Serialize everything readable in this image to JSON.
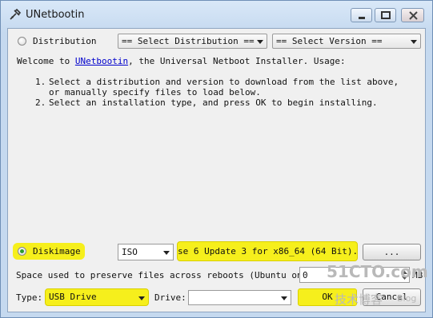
{
  "window": {
    "title": "UNetbootin"
  },
  "distribution": {
    "label": "Distribution",
    "select_distribution": "== Select Distribution ==",
    "select_version": "== Select Version =="
  },
  "welcome": {
    "prefix": "Welcome to ",
    "link": "UNetbootin",
    "suffix": ", the Universal Netboot Installer. Usage:"
  },
  "instructions": [
    {
      "num": "1.",
      "text": "Select a distribution and version to download from the list above, or manually specify files to load below."
    },
    {
      "num": "2.",
      "text": "Select an installation type, and press OK to begin installing."
    }
  ],
  "diskimage": {
    "label": "Diskimage",
    "type_value": "ISO",
    "file_path": "se 6 Update 3 for x86_64 (64 Bit).iso",
    "browse_label": "..."
  },
  "persistence": {
    "label": "Space used to preserve files across reboots (Ubuntu only):",
    "value": "0",
    "unit": "MB"
  },
  "install": {
    "type_label": "Type:",
    "type_value": "USB Drive",
    "drive_label": "Drive:",
    "drive_value": ""
  },
  "buttons": {
    "ok": "OK",
    "cancel": "Cancel"
  },
  "watermark": {
    "line1": "51CTO.com",
    "line2": "技术博客",
    "line3": "Blog"
  },
  "colors": {
    "highlight": "#f6ef1c",
    "radio_checked": "#2e9a2e",
    "link": "#0000cc"
  }
}
